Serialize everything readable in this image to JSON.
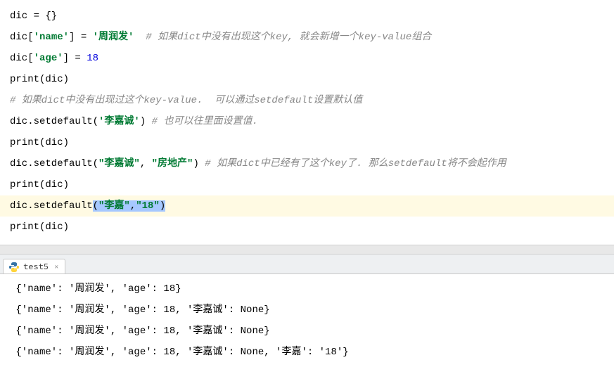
{
  "code": {
    "lines": [
      {
        "segments": [
          {
            "t": "dic = {}",
            "cls": "plain"
          }
        ]
      },
      {
        "segments": [
          {
            "t": "dic[",
            "cls": "plain"
          },
          {
            "t": "'name'",
            "cls": "str"
          },
          {
            "t": "] = ",
            "cls": "plain"
          },
          {
            "t": "'周润发'",
            "cls": "str"
          },
          {
            "t": "  ",
            "cls": "plain"
          },
          {
            "t": "# 如果dict中没有出现这个key, 就会新增一个key-value组合",
            "cls": "comment"
          }
        ]
      },
      {
        "segments": [
          {
            "t": "dic[",
            "cls": "plain"
          },
          {
            "t": "'age'",
            "cls": "str"
          },
          {
            "t": "] = ",
            "cls": "plain"
          },
          {
            "t": "18",
            "cls": "num"
          }
        ]
      },
      {
        "segments": [
          {
            "t": "print(dic)",
            "cls": "plain"
          }
        ]
      },
      {
        "segments": [
          {
            "t": "# 如果dict中没有出现过这个key-value.  可以通过setdefault设置默认值",
            "cls": "comment"
          }
        ]
      },
      {
        "segments": [
          {
            "t": "dic.setdefault(",
            "cls": "plain"
          },
          {
            "t": "'李嘉诚'",
            "cls": "str"
          },
          {
            "t": ") ",
            "cls": "plain"
          },
          {
            "t": "# 也可以往里面设置值.",
            "cls": "comment"
          }
        ]
      },
      {
        "segments": [
          {
            "t": "print(dic)",
            "cls": "plain"
          }
        ]
      },
      {
        "segments": [
          {
            "t": "dic.setdefault(",
            "cls": "plain"
          },
          {
            "t": "\"李嘉诚\"",
            "cls": "str"
          },
          {
            "t": ", ",
            "cls": "plain"
          },
          {
            "t": "\"房地产\"",
            "cls": "str"
          },
          {
            "t": ") ",
            "cls": "plain"
          },
          {
            "t": "# 如果dict中已经有了这个key了. 那么setdefault将不会起作用",
            "cls": "comment"
          }
        ]
      },
      {
        "segments": [
          {
            "t": "print(dic)",
            "cls": "plain"
          }
        ]
      },
      {
        "segments": [
          {
            "t": "dic.setdefault",
            "cls": "plain"
          },
          {
            "t": "(",
            "cls": "plain sel"
          },
          {
            "t": "\"李嘉\"",
            "cls": "str sel"
          },
          {
            "t": ",",
            "cls": "plain sel"
          },
          {
            "t": "\"18\"",
            "cls": "str sel"
          },
          {
            "t": ")",
            "cls": "plain sel"
          }
        ],
        "highlighted": true
      },
      {
        "segments": [
          {
            "t": "print(dic)",
            "cls": "plain"
          }
        ]
      }
    ]
  },
  "tab": {
    "label": "test5",
    "close": "×"
  },
  "output": {
    "lines": [
      " {'name': '周润发', 'age': 18}",
      " {'name': '周润发', 'age': 18, '李嘉诚': None}",
      " {'name': '周润发', 'age': 18, '李嘉诚': None}",
      " {'name': '周润发', 'age': 18, '李嘉诚': None, '李嘉': '18'}"
    ]
  }
}
